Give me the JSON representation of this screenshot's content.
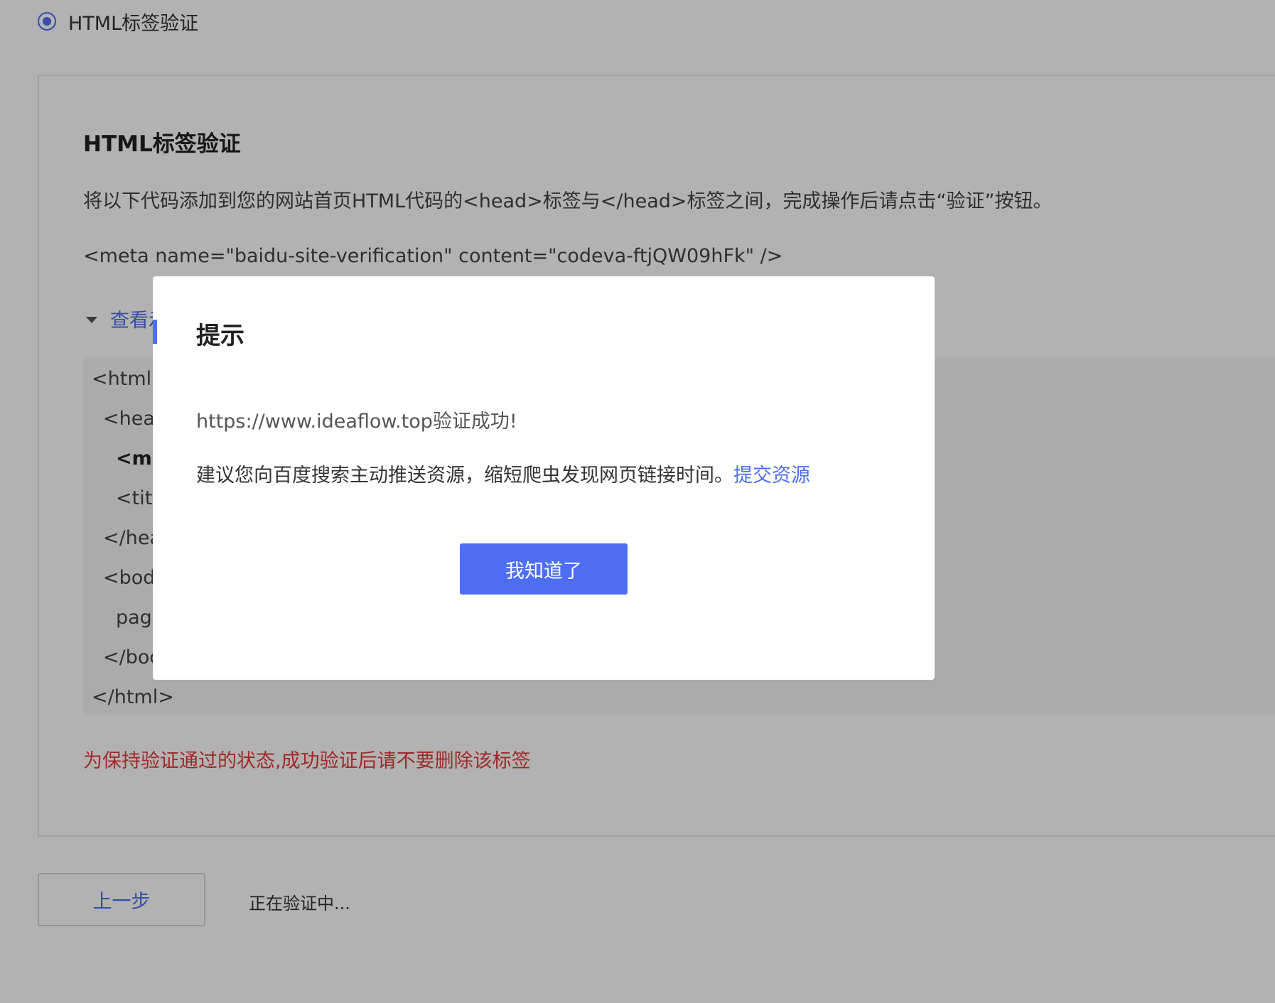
{
  "method_option": {
    "label": "HTML标签验证",
    "selected": true
  },
  "panel": {
    "title": "HTML标签验证",
    "description": "将以下代码添加到您的网站首页HTML代码的<head>标签与</head>标签之间，完成操作后请点击“验证”按钮。",
    "meta_code": "<meta name=\"baidu-site-verification\" content=\"codeva-ftjQW09hFk\" />",
    "toggle_label": "查看示例",
    "code_lines": [
      "<html>",
      "<head>",
      "<meta",
      "<title>",
      "</head>",
      "<body>",
      "page",
      "</body>",
      "</html>"
    ],
    "warning": "为保持验证通过的状态,成功验证后请不要删除该标签"
  },
  "footer": {
    "prev_label": "上一步",
    "status": "正在验证中..."
  },
  "modal": {
    "title": "提示",
    "message_success": "https://www.ideaflow.top验证成功!",
    "message_suggest": "建议您向百度搜索主动推送资源，缩短爬虫发现网页链接时间。",
    "link_label": "提交资源",
    "ok_label": "我知道了"
  },
  "colors": {
    "accent": "#4e6ef2",
    "warning": "#e43b3b",
    "overlay": "rgba(0,0,0,0.30)"
  }
}
